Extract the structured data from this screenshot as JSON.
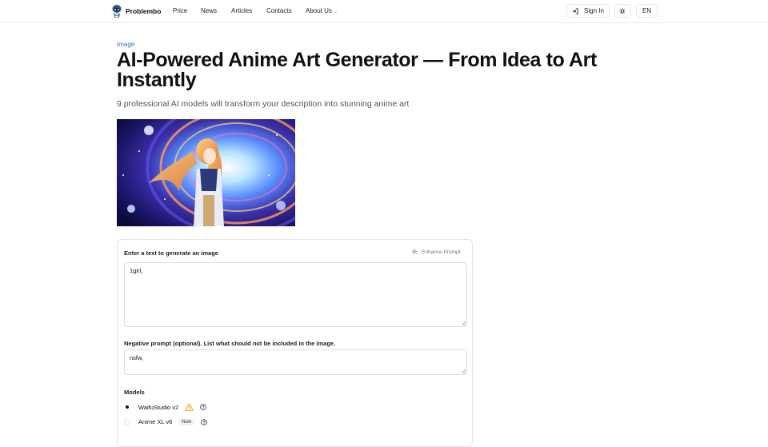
{
  "header": {
    "brand": "Problembo",
    "nav": [
      "Price",
      "News",
      "Articles",
      "Contacts",
      "About Us"
    ],
    "sign_in": "Sign In",
    "language": "EN",
    "theme_icon": "sun-icon"
  },
  "main": {
    "category": "Image",
    "title": "AI-Powered Anime Art Generator — From Idea to Art Instantly",
    "subtitle": "9 professional AI models will transform your description into stunning anime art"
  },
  "form": {
    "prompt_label": "Enter a text to generate an image",
    "enhance_label": "Enhance Prompt",
    "prompt_value": "1girl,",
    "negative_label": "Negative prompt (optional). List what should not be included in the image.",
    "negative_value": "nsfw,",
    "models_label": "Models",
    "models": [
      {
        "name": "WaifuStudio v2",
        "selected": true,
        "badge": ""
      },
      {
        "name": "Anime XL v6",
        "selected": false,
        "badge": "New"
      }
    ]
  },
  "colors": {
    "accent": "#2a6fdb",
    "warning": "#e8a600",
    "border": "#e6e6e6"
  }
}
